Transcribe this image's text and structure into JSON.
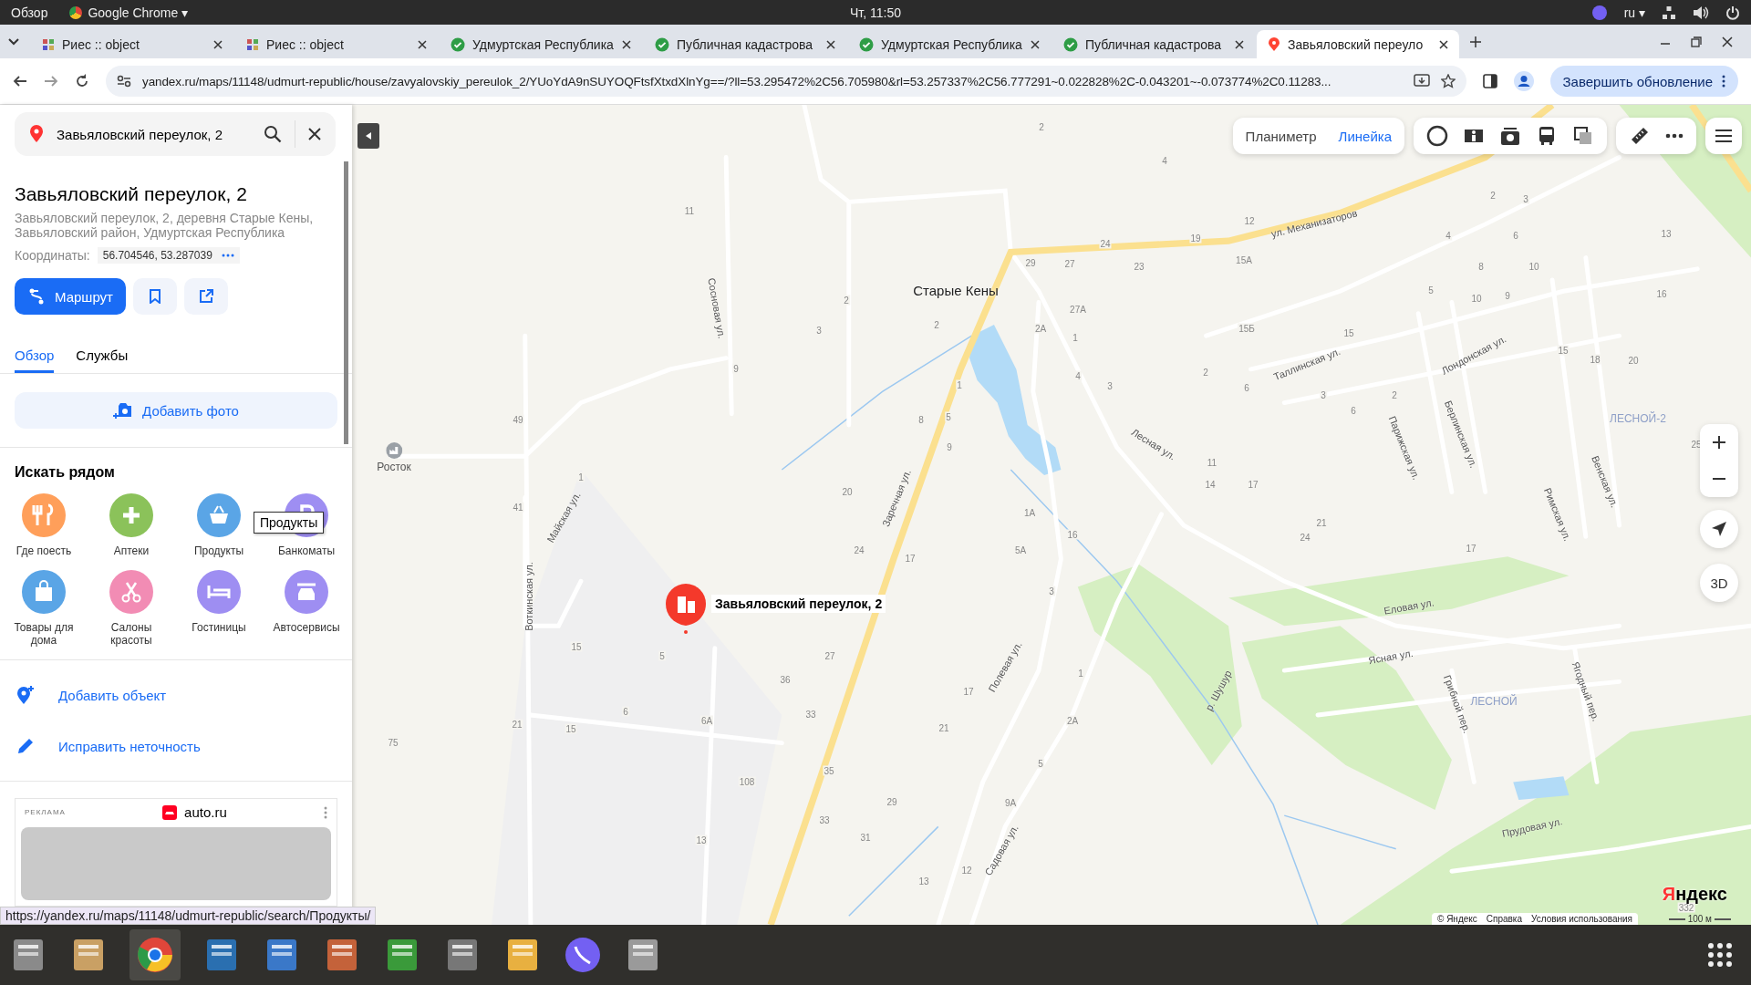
{
  "system_bar": {
    "activities": "Обзор",
    "app": "Google Chrome ▾",
    "clock": "Чт, 11:50",
    "language": "ru ▾"
  },
  "tabs": [
    {
      "title": "Риес :: object",
      "kind": "grid",
      "selected": false
    },
    {
      "title": "Риес :: object",
      "kind": "grid",
      "selected": false
    },
    {
      "title": "Удмуртская Республика",
      "kind": "check",
      "selected": false
    },
    {
      "title": "Публичная кадастрова",
      "kind": "check",
      "selected": false
    },
    {
      "title": "Удмуртская Республика",
      "kind": "check",
      "selected": false
    },
    {
      "title": "Публичная кадастрова",
      "kind": "check",
      "selected": false
    },
    {
      "title": "Завьяловский переуло",
      "kind": "pin",
      "selected": true
    }
  ],
  "address_bar": {
    "url": "yandex.ru/maps/11148/udmurt-republic/house/zavyalovskiy_pereulok_2/YUoYdA9nSUYOQFtsfXtxdXlnYg==/?ll=53.295472%2C56.705980&rl=53.257337%2C56.777291~0.022828%2C-0.043201~-0.073774%2C0.11283...",
    "update_button": "Завершить обновление"
  },
  "panel": {
    "search": {
      "value": "Завьяловский переулок, 2"
    },
    "title": "Завьяловский переулок, 2",
    "address": "Завьяловский переулок, 2, деревня Старые Кены, Завьяловский район, Удмуртская Республика",
    "coordinates_label": "Координаты:",
    "coordinates": "56.704546, 53.287039",
    "route_button": "Маршрут",
    "sections": [
      {
        "label": "Обзор",
        "selected": true
      },
      {
        "label": "Службы",
        "selected": false
      }
    ],
    "add_photo": "Добавить фото",
    "nearby_title": "Искать рядом",
    "nearby": [
      {
        "label": "Где поесть",
        "kind": "food",
        "color": "#ff9f5a"
      },
      {
        "label": "Аптеки",
        "kind": "pharmacy",
        "color": "#8bc25a"
      },
      {
        "label": "Продукты",
        "kind": "basket",
        "color": "#5aa5e6"
      },
      {
        "label": "Банкоматы",
        "kind": "atm",
        "color": "#9e8ef2"
      },
      {
        "label": "Товары для дома",
        "kind": "bag",
        "color": "#5aa5e6"
      },
      {
        "label": "Салоны красоты",
        "kind": "scissors",
        "color": "#f28cb4"
      },
      {
        "label": "Гостиницы",
        "kind": "bed",
        "color": "#9e8ef2"
      },
      {
        "label": "Автосервисы",
        "kind": "car",
        "color": "#9e8ef2"
      }
    ],
    "tooltip": "Продукты",
    "actions": [
      {
        "label": "Добавить объект",
        "kind": "add-place"
      },
      {
        "label": "Исправить неточность",
        "kind": "edit"
      }
    ],
    "ad": {
      "label": "РЕКЛАМА",
      "brand": "auto.ru"
    }
  },
  "map": {
    "tools": [
      {
        "label": "Планиметр",
        "selected": false
      },
      {
        "label": "Линейка",
        "selected": true
      }
    ],
    "settlement": "Старые Кены",
    "poi": "Росток",
    "marker_label": "Завьяловский переулок, 2",
    "streets": [
      "ул. Механизаторов",
      "Сосновая ул.",
      "Майская ул.",
      "Воткинская ул.",
      "Заречная ул.",
      "Лесная ул.",
      "Таллинская ул.",
      "Лондонская ул.",
      "Парижская ул.",
      "Берлинская ул.",
      "Римская ул.",
      "Венская ул.",
      "Еловая ул.",
      "Ясная ул.",
      "Грибной пер.",
      "Ягодный пер.",
      "Полевая ул.",
      "Садовая ул.",
      "р. Шушур",
      "Прудовая ул."
    ],
    "districts": [
      "ЛЕСНОЙ-2",
      "ЛЕСНОЙ"
    ],
    "house_numbers": [
      "2",
      "4",
      "24",
      "19",
      "12",
      "29",
      "27",
      "23",
      "15А",
      "27А",
      "2А",
      "2",
      "1",
      "15Б",
      "1",
      "4",
      "3",
      "8",
      "5",
      "9",
      "20",
      "24",
      "17",
      "1А",
      "5А",
      "16",
      "3",
      "11",
      "14",
      "17",
      "21",
      "24",
      "2",
      "6",
      "15",
      "3",
      "2",
      "6",
      "17",
      "5",
      "2",
      "3",
      "4",
      "6",
      "8",
      "10",
      "9",
      "10",
      "13",
      "16",
      "20",
      "18",
      "15",
      "25",
      "11",
      "2",
      "3",
      "9",
      "49",
      "1",
      "41",
      "15",
      "5",
      "6",
      "21",
      "15",
      "75",
      "6А",
      "108",
      "13",
      "36",
      "27",
      "33",
      "35",
      "29",
      "33",
      "31",
      "13",
      "12",
      "21",
      "17",
      "5",
      "9А",
      "2А",
      "1",
      "332"
    ],
    "three_d": "3D",
    "logo": "Яндекс",
    "footer_links": [
      "© Яндекс",
      "Справка",
      "Условия использования"
    ],
    "scale": "100 м"
  },
  "status_url": "https://yandex.ru/maps/11148/udmurt-republic/search/Продукты/"
}
